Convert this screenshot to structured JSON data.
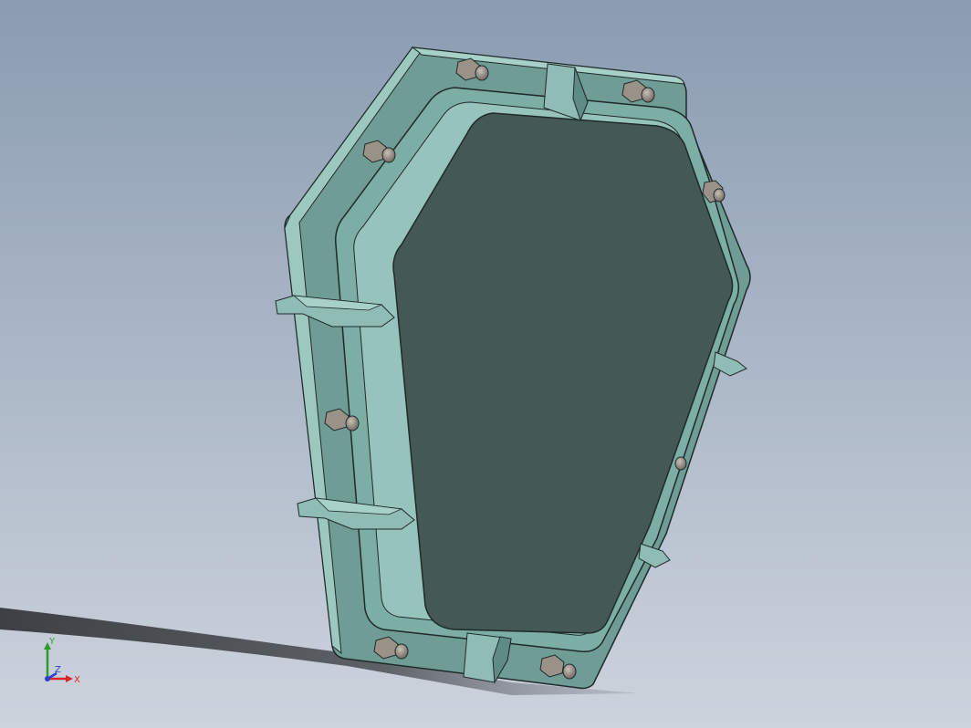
{
  "colors": {
    "bg_top": "#8A9CB1",
    "bg_bottom": "#CDD3DD",
    "cover_face": "#445856",
    "frame_light": "#8FBDB5",
    "frame_mid": "#77A8A0",
    "frame_dark": "#4F7671",
    "edge": "#1E2A29",
    "bolt": "#9A9189",
    "bolt_dark": "#4B4540",
    "shadow": "#3C3E42",
    "axis_x": "#D62828",
    "axis_y": "#2E9A2E",
    "axis_z": "#2B3FC8"
  },
  "triad": {
    "x_label": "X",
    "y_label": "Y",
    "z_label": "Z"
  }
}
